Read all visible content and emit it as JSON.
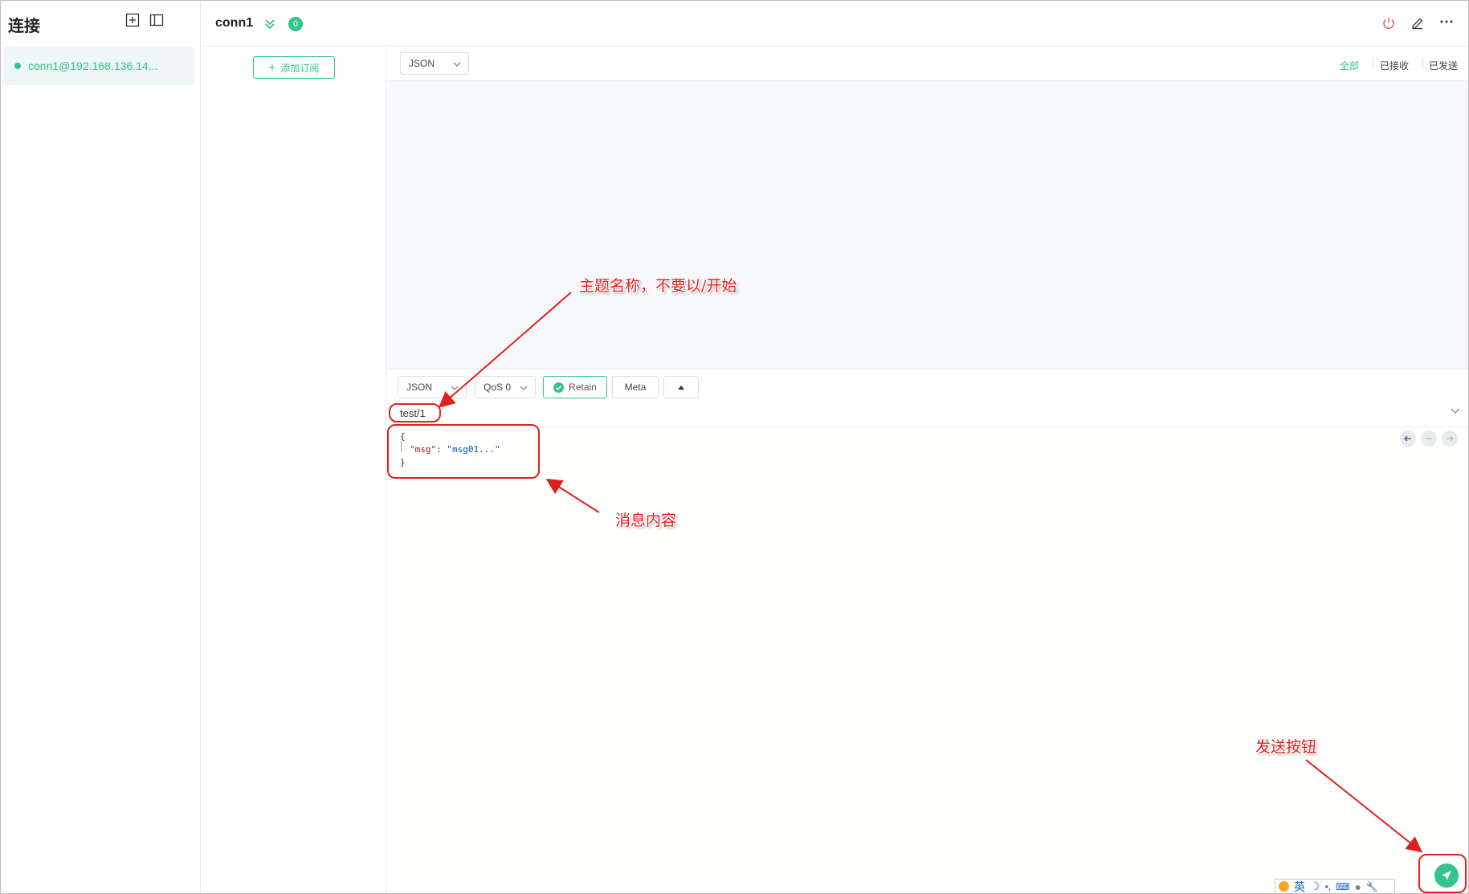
{
  "sidebar": {
    "title": "连接",
    "connection": {
      "label": "conn1@192.168.136.14..."
    }
  },
  "header": {
    "conn_name": "conn1",
    "unread_count": "0"
  },
  "subscriptions": {
    "add_label": "添加订阅"
  },
  "messages": {
    "format_select": "JSON",
    "filters": [
      "全部",
      "已接收",
      "已发送"
    ],
    "active_filter": "全部"
  },
  "publish": {
    "format_select": "JSON",
    "qos_select": "QoS 0",
    "retain_label": "Retain",
    "meta_label": "Meta",
    "topic": "test/1",
    "payload": {
      "open": "{",
      "key": "\"msg\"",
      "colon": ": ",
      "value": "\"msg01...\"",
      "close": "}"
    }
  },
  "ime": {
    "lang": "英"
  },
  "annotations": {
    "topic_note": "主题名称，不要以/开始",
    "payload_note": "消息内容",
    "send_note": "发送按钮"
  },
  "colors": {
    "accent": "#34c388",
    "annotation": "#e02020",
    "power": "#e05a5a"
  }
}
